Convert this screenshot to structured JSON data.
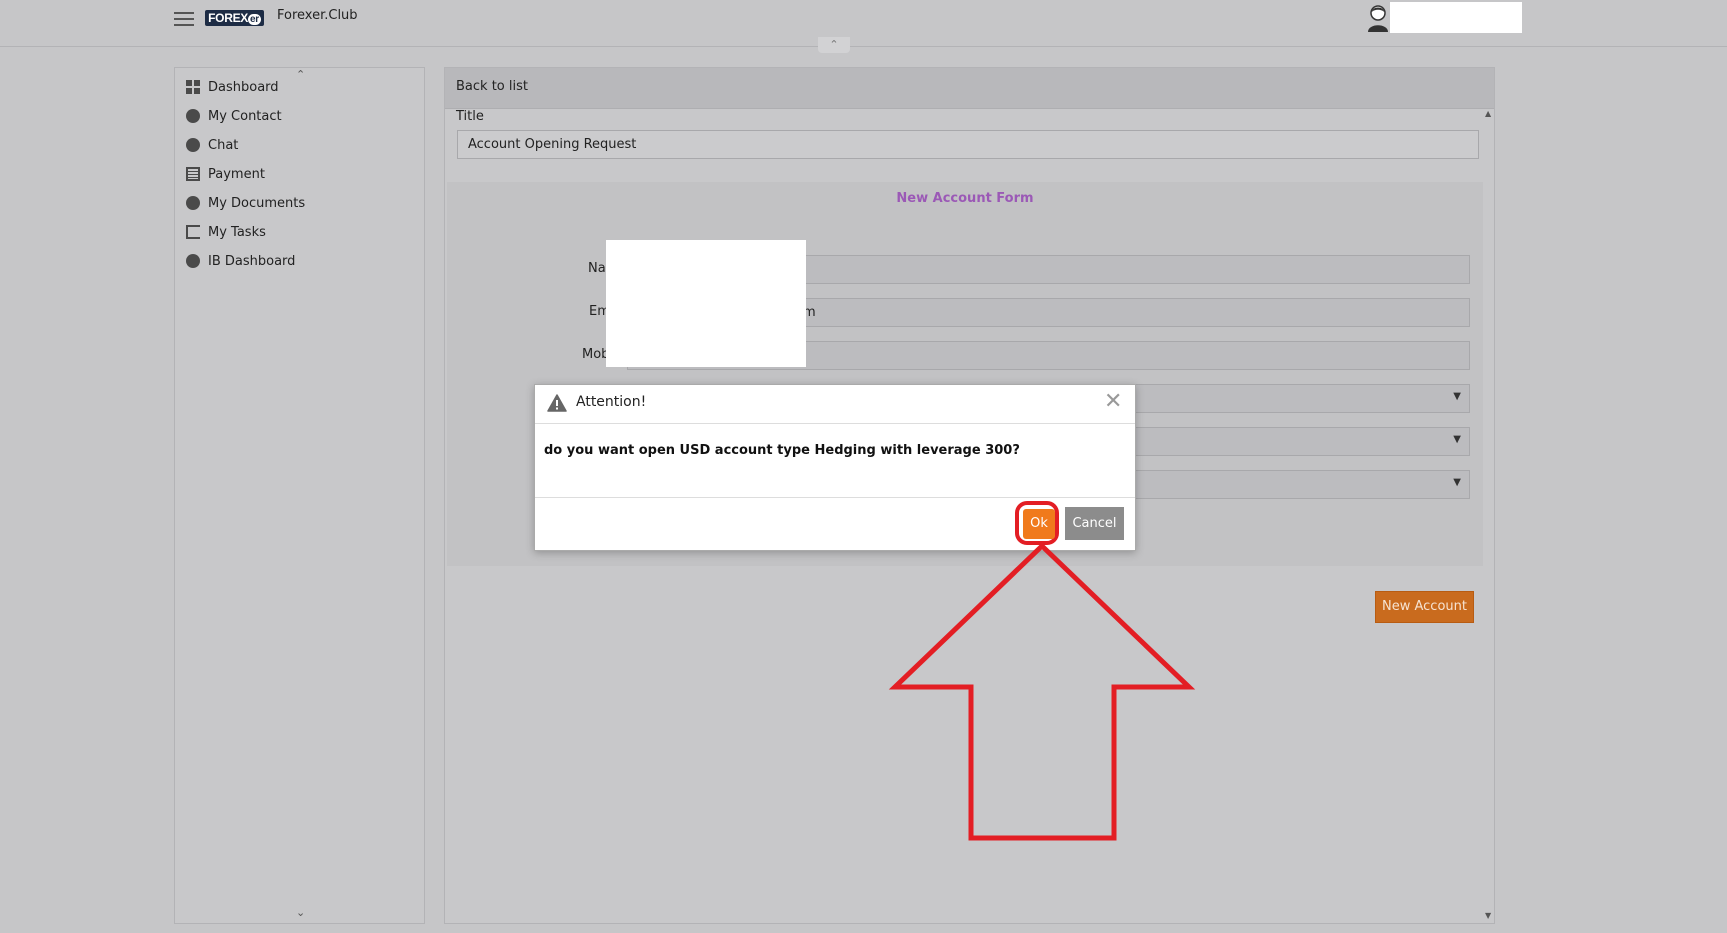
{
  "header": {
    "logo_main": "FOREX",
    "logo_suffix": "er",
    "site_name": "Forexer.Club",
    "collapse_glyph": "⌃"
  },
  "sidebar": {
    "items": [
      {
        "label": "Dashboard",
        "icon": "dashboard-icon"
      },
      {
        "label": "My Contact",
        "icon": "contact-icon"
      },
      {
        "label": "Chat",
        "icon": "chat-icon"
      },
      {
        "label": "Payment",
        "icon": "payment-icon"
      },
      {
        "label": "My Documents",
        "icon": "documents-icon"
      },
      {
        "label": "My Tasks",
        "icon": "tasks-icon"
      },
      {
        "label": "IB Dashboard",
        "icon": "ib-dashboard-icon"
      }
    ],
    "scroll_up": "⌃",
    "scroll_down": "⌄"
  },
  "main": {
    "back_link": "Back to list",
    "title_label": "Title",
    "title_value": "Account Opening Request",
    "form_title": "New Account Form",
    "fields": {
      "name_label": "Nar",
      "email_label": "Em",
      "email_value_tail": "m",
      "mobile_label": "Mob"
    },
    "new_account_button": "New Account"
  },
  "modal": {
    "title": "Attention!",
    "close_glyph": "✕",
    "message": "do you want open USD account type Hedging with leverage 300?",
    "ok_label": "Ok",
    "cancel_label": "Cancel"
  },
  "colors": {
    "accent_orange": "#f07a1c",
    "new_account_orange": "#c96b1e",
    "form_title_purple": "#9b59b6",
    "annotation_red": "#e31e24"
  }
}
